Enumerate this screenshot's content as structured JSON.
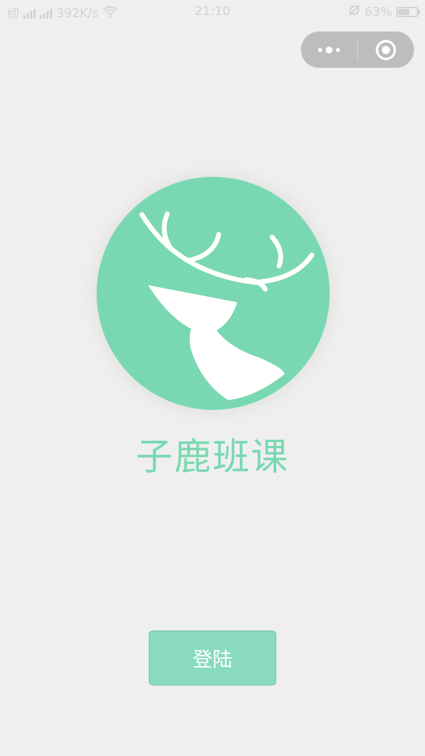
{
  "status_bar": {
    "carrier_left": "纫",
    "network_speed": "392K/s",
    "time": "21:10",
    "battery_percent": "63%",
    "battery_level": 0.63,
    "icons": [
      "signal-icon",
      "wifi-icon",
      "alarm-off-icon",
      "battery-icon"
    ]
  },
  "capsule": {
    "icons": [
      "more-dots-icon",
      "close-target-icon"
    ]
  },
  "app": {
    "title": "子鹿班课",
    "logo_icon": "deer-logo-icon",
    "brand_color": "#79d8b2"
  },
  "login": {
    "label": "登陆"
  }
}
